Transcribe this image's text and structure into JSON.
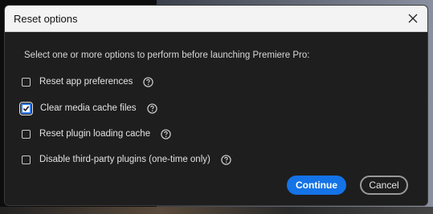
{
  "window": {
    "title": "Reset options",
    "close_icon": "close-icon"
  },
  "prompt": "Select one or more options to perform before launching Premiere Pro:",
  "options": [
    {
      "label": "Reset app preferences",
      "checked": false,
      "help_icon": "help-circle-icon"
    },
    {
      "label": "Clear media cache files",
      "checked": true,
      "help_icon": "help-circle-icon"
    },
    {
      "label": "Reset plugin loading cache",
      "checked": false,
      "help_icon": "help-circle-icon"
    },
    {
      "label": "Disable third-party plugins (one-time only)",
      "checked": false,
      "help_icon": "help-circle-icon"
    }
  ],
  "buttons": {
    "continue_label": "Continue",
    "cancel_label": "Cancel"
  },
  "colors": {
    "accent": "#1473e6",
    "dialog_bg": "#1e1e1e",
    "titlebar_bg": "#f3f3f3"
  }
}
